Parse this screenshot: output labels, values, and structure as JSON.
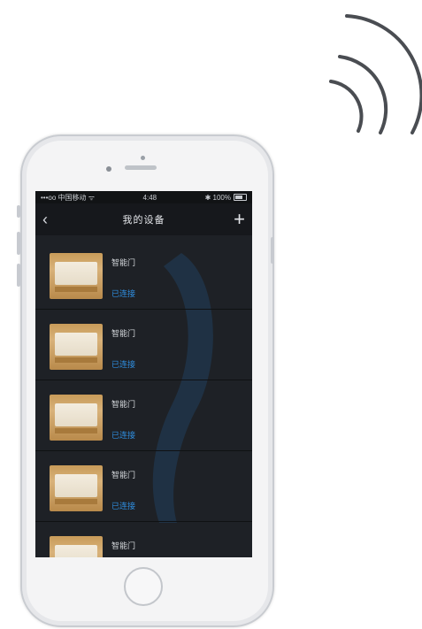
{
  "icons": {
    "signal": "wireless-signal-icon",
    "back": "back-arrow-icon",
    "add": "plus-icon"
  },
  "colors": {
    "screen_bg": "#1e2126",
    "status_link": "#2f8ee0"
  },
  "statusbar": {
    "carrier": "•••oo 中国移动 ᯤ",
    "time": "4:48",
    "right": "✱ 100%"
  },
  "navbar": {
    "back_glyph": "‹",
    "title": "我的设备",
    "add_glyph": "+"
  },
  "devices": [
    {
      "name": "智能门",
      "status": "已连接"
    },
    {
      "name": "智能门",
      "status": "已连接"
    },
    {
      "name": "智能门",
      "status": "已连接"
    },
    {
      "name": "智能门",
      "status": "已连接"
    },
    {
      "name": "智能门",
      "status": ""
    }
  ]
}
